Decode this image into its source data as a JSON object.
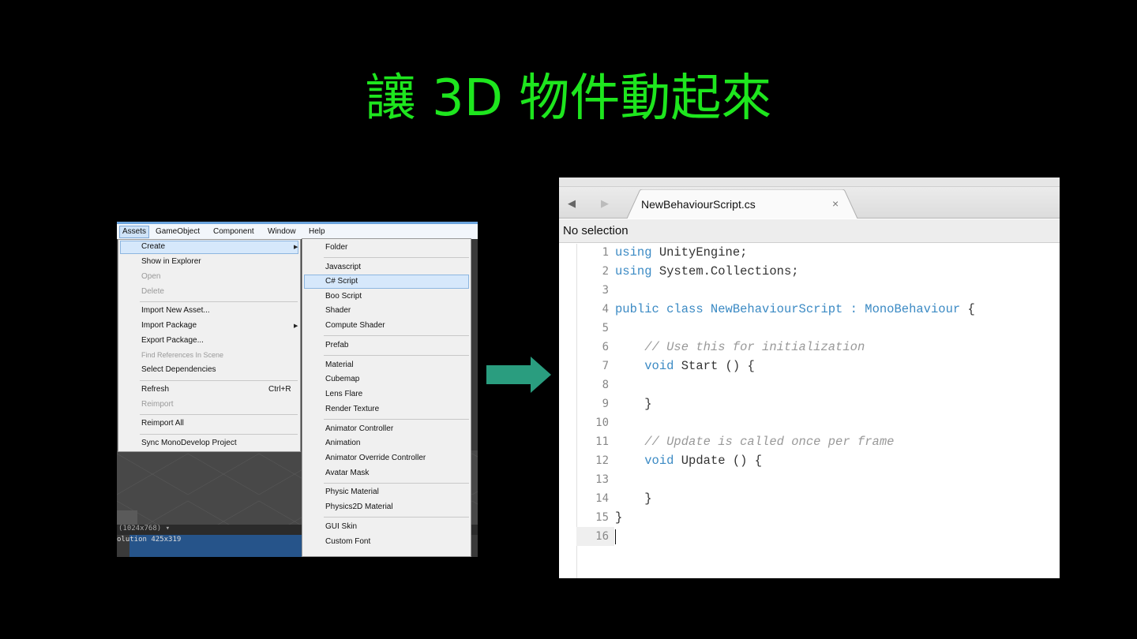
{
  "slide": {
    "title": "讓 3D 物件動起來"
  },
  "unity": {
    "menubar": [
      "Assets",
      "GameObject",
      "Component",
      "Window",
      "Help"
    ],
    "assets_menu": [
      {
        "label": "Create",
        "submenu": true,
        "highlight": true
      },
      {
        "label": "Show in Explorer"
      },
      {
        "label": "Open",
        "disabled": true
      },
      {
        "label": "Delete",
        "disabled": true
      },
      {
        "label": "Import New Asset..."
      },
      {
        "label": "Import Package",
        "submenu": true
      },
      {
        "label": "Export Package..."
      },
      {
        "label": "Find References In Scene",
        "disabled": true
      },
      {
        "label": "Select Dependencies"
      },
      {
        "label": "Refresh",
        "shortcut": "Ctrl+R"
      },
      {
        "label": "Reimport",
        "disabled": true
      },
      {
        "label": "Reimport All"
      },
      {
        "label": "Sync MonoDevelop Project"
      }
    ],
    "create_menu": [
      "Folder",
      "Javascript",
      "C# Script",
      "Boo Script",
      "Shader",
      "Compute Shader",
      "Prefab",
      "Material",
      "Cubemap",
      "Lens Flare",
      "Render Texture",
      "Animator Controller",
      "Animation",
      "Animator Override Controller",
      "Avatar Mask",
      "Physic Material",
      "Physics2D Material",
      "GUI Skin",
      "Custom Font"
    ],
    "selected_create_item": "C# Script",
    "status_line1": "(1024x768)   ▾",
    "status_line2": "olution 425x319"
  },
  "editor": {
    "tab_title": "NewBehaviourScript.cs",
    "tab_close": "×",
    "nav_back": "◀",
    "nav_forward": "▶",
    "selection_label": "No selection",
    "line_numbers": [
      "1",
      "2",
      "3",
      "4",
      "5",
      "6",
      "7",
      "8",
      "9",
      "10",
      "11",
      "12",
      "13",
      "14",
      "15",
      "16"
    ],
    "code": {
      "l1_kw": "using",
      "l1_rest": " UnityEngine;",
      "l2_kw": "using",
      "l2_rest": " System.Collections;",
      "l4_kw": "public class",
      "l4_name": " NewBehaviourScript : ",
      "l4_type": "MonoBehaviour",
      "l4_end": " {",
      "l6": "    // Use this for initialization",
      "l7": "    void Start () {",
      "l9": "    }",
      "l11": "    // Update is called once per frame",
      "l12": "    void Update () {",
      "l14": "    }",
      "l15": "}"
    }
  },
  "colors": {
    "title": "#1ee61e",
    "arrow": "#2a9d7f",
    "keyword": "#3b8ac4"
  }
}
